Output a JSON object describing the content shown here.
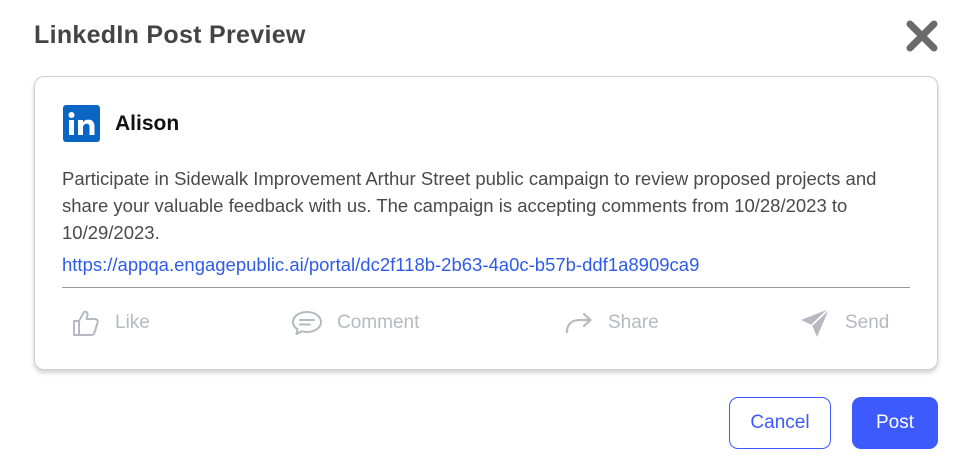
{
  "dialog": {
    "title": "LinkedIn Post Preview"
  },
  "preview": {
    "logo_text": "in",
    "author": "Alison",
    "text": "Participate in Sidewalk Improvement Arthur Street public campaign to review proposed projects and share your valuable feedback with us. The campaign is accepting comments from 10/28/2023 to 10/29/2023.",
    "link": "https://appqa.engagepublic.ai/portal/dc2f118b-2b63-4a0c-b57b-ddf1a8909ca9",
    "actions": {
      "like": "Like",
      "comment": "Comment",
      "share": "Share",
      "send": "Send"
    }
  },
  "buttons": {
    "cancel": "Cancel",
    "post": "Post"
  },
  "colors": {
    "accent": "#3d5afe",
    "linkedin": "#0a66c2",
    "link": "#2f5bea",
    "muted_action": "#b7b9c0",
    "close_icon": "#6b6b6b"
  },
  "icons": {
    "close": "close-icon",
    "like": "thumbs-up-icon",
    "comment": "comment-icon",
    "share": "share-arrow-icon",
    "send": "send-icon"
  }
}
